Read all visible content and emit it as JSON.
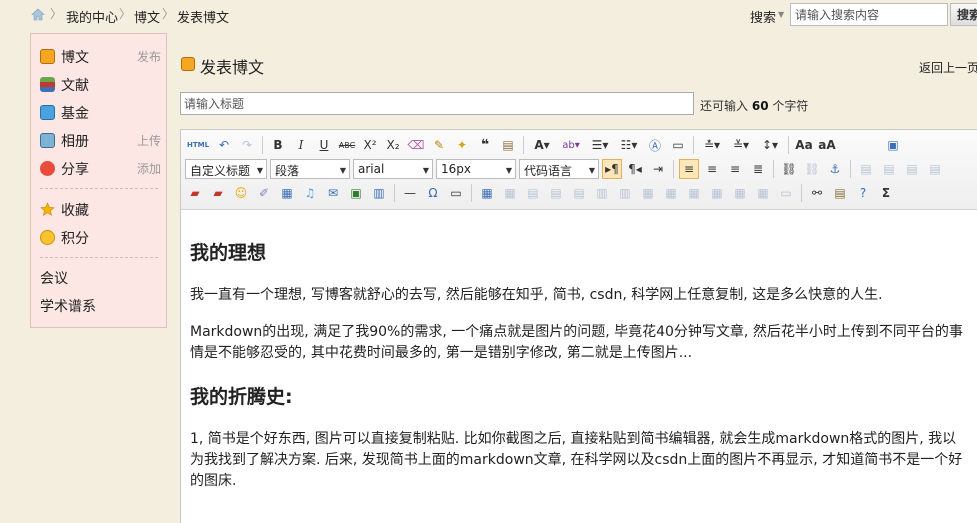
{
  "breadcrumb": {
    "items": [
      "我的中心",
      "博文",
      "发表博文"
    ],
    "separator": "〉"
  },
  "search": {
    "label": "搜索",
    "placeholder": "请输入搜索内容",
    "button_label": "搜索"
  },
  "sidebar": {
    "items": [
      {
        "label": "博文",
        "action": "发布",
        "icon": "blog-icon"
      },
      {
        "label": "文献",
        "action": "",
        "icon": "books-icon"
      },
      {
        "label": "基金",
        "action": "",
        "icon": "person-card-icon"
      },
      {
        "label": "相册",
        "action": "上传",
        "icon": "photo-icon"
      },
      {
        "label": "分享",
        "action": "添加",
        "icon": "heart-share-icon"
      },
      {
        "label": "收藏",
        "action": "",
        "icon": "star-icon"
      },
      {
        "label": "积分",
        "action": "",
        "icon": "coins-icon"
      }
    ],
    "plain_items": [
      "会议",
      "学术谱系"
    ]
  },
  "page": {
    "title": "发表博文",
    "back_label": "返回上一页",
    "title_placeholder": "请输入标题",
    "remain_prefix": "还可输入",
    "remain_count": "60",
    "remain_suffix": "个字符"
  },
  "toolbar": {
    "heading_select": "自定义标题",
    "paragraph_select": "段落",
    "font_select": "arial",
    "size_select": "16px",
    "code_select": "代码语言"
  },
  "content": {
    "heading1": "我的理想",
    "para1": "我一直有一个理想, 写博客就舒心的去写, 然后能够在知乎, 简书, csdn, 科学网上任意复制, 这是多么快意的人生.",
    "para2": "Markdown的出现, 满足了我90%的需求, 一个痛点就是图片的问题, 毕竟花40分钟写文章, 然后花半小时上传到不同平台的事情是不能够忍受的, 其中花费时间最多的, 第一是错别字修改, 第二就是上传图片...",
    "heading2": "我的折腾史:",
    "para3": "1, 简书是个好东西, 图片可以直接复制粘贴. 比如你截图之后, 直接粘贴到简书编辑器, 就会生成markdown格式的图片, 我以为我找到了解决方案. 后来, 发现简书上面的markdown文章, 在科学网以及csdn上面的图片不再显示, 才知道简书不是一个好的图床."
  },
  "colors": {
    "background": "#f4eedf",
    "sidebar_bg": "#fde7e4",
    "toolbar_selected": "#fde6b8"
  }
}
